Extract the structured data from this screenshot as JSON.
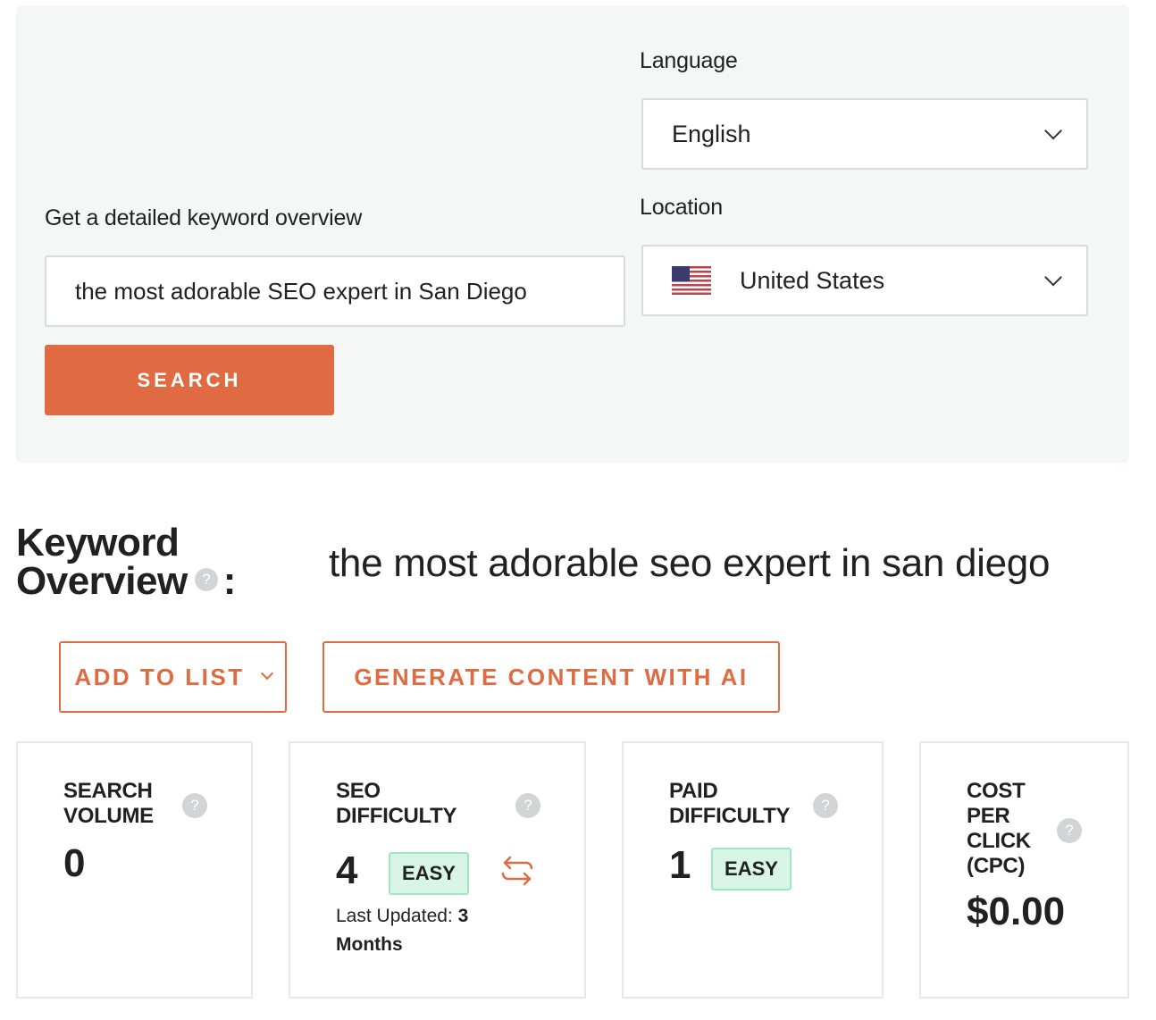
{
  "search_panel": {
    "keyword_label": "Get a detailed keyword overview",
    "keyword_input_value": "the most adorable SEO expert in San Diego",
    "language_label": "Language",
    "language_value": "English",
    "location_label": "Location",
    "location_value": "United States",
    "location_flag": "us-flag-icon",
    "search_button": "SEARCH"
  },
  "overview": {
    "title_line1": "Keyword",
    "title_line2": "Overview",
    "help_glyph": "?",
    "colon": ":",
    "keyword": "the most adorable seo expert in san diego",
    "add_to_list_button": "ADD TO LIST",
    "generate_button": "GENERATE CONTENT WITH AI"
  },
  "cards": [
    {
      "title_lines": [
        "SEARCH",
        "VOLUME"
      ],
      "value": "0"
    },
    {
      "title_lines": [
        "SEO",
        "DIFFICULTY"
      ],
      "value": "4",
      "badge": "EASY",
      "updated_label": "Last Updated:",
      "updated_value_1": "3",
      "updated_value_2": "Months"
    },
    {
      "title_lines": [
        "PAID",
        "DIFFICULTY"
      ],
      "value": "1",
      "badge": "EASY"
    },
    {
      "title_lines": [
        "COST",
        "PER",
        "CLICK",
        "(CPC)"
      ],
      "value": "$0.00"
    }
  ],
  "colors": {
    "accent": "#e06b43",
    "panel_bg": "#f5f7f7",
    "badge_bg": "#d8f5e8",
    "badge_border": "#9fe6c3",
    "help_icon": "#d3d4d6"
  }
}
